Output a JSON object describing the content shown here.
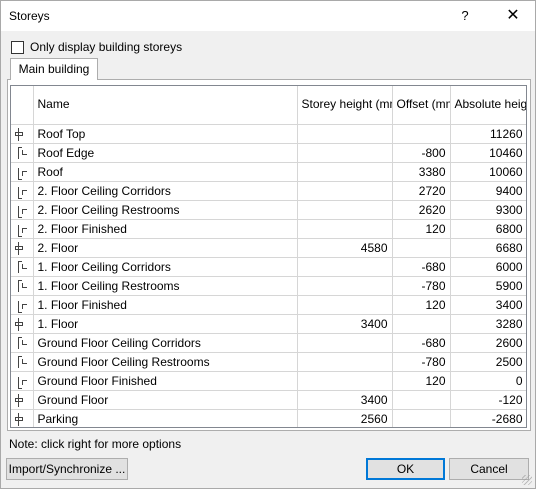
{
  "window": {
    "title": "Storeys",
    "help": "?",
    "close": "✕"
  },
  "only_building_label": "Only display building storeys",
  "tab_label": "Main building",
  "columns": {
    "name": "Name",
    "storey_height": "Storey height (mm)",
    "offset": "Offset (mm)",
    "absolute": "Absolute height (mm)"
  },
  "rows": [
    {
      "icon": "storey",
      "name": "Roof Top",
      "storey_height": "",
      "offset": "",
      "absolute": "11260"
    },
    {
      "icon": "above",
      "name": "Roof Edge",
      "storey_height": "",
      "offset": "-800",
      "absolute": "10460"
    },
    {
      "icon": "below",
      "name": "Roof",
      "storey_height": "",
      "offset": "3380",
      "absolute": "10060"
    },
    {
      "icon": "below",
      "name": "2. Floor Ceiling Corridors",
      "storey_height": "",
      "offset": "2720",
      "absolute": "9400"
    },
    {
      "icon": "below",
      "name": "2. Floor Ceiling Restrooms",
      "storey_height": "",
      "offset": "2620",
      "absolute": "9300"
    },
    {
      "icon": "below",
      "name": "2. Floor Finished",
      "storey_height": "",
      "offset": "120",
      "absolute": "6800"
    },
    {
      "icon": "storey",
      "name": "2. Floor",
      "storey_height": "4580",
      "offset": "",
      "absolute": "6680"
    },
    {
      "icon": "above",
      "name": "1. Floor Ceiling Corridors",
      "storey_height": "",
      "offset": "-680",
      "absolute": "6000"
    },
    {
      "icon": "above",
      "name": "1. Floor Ceiling Restrooms",
      "storey_height": "",
      "offset": "-780",
      "absolute": "5900"
    },
    {
      "icon": "below",
      "name": "1. Floor Finished",
      "storey_height": "",
      "offset": "120",
      "absolute": "3400"
    },
    {
      "icon": "storey",
      "name": "1. Floor",
      "storey_height": "3400",
      "offset": "",
      "absolute": "3280"
    },
    {
      "icon": "above",
      "name": "Ground Floor Ceiling Corridors",
      "storey_height": "",
      "offset": "-680",
      "absolute": "2600"
    },
    {
      "icon": "above",
      "name": "Ground Floor Ceiling Restrooms",
      "storey_height": "",
      "offset": "-780",
      "absolute": "2500"
    },
    {
      "icon": "below",
      "name": "Ground Floor Finished",
      "storey_height": "",
      "offset": "120",
      "absolute": "0"
    },
    {
      "icon": "storey",
      "name": "Ground Floor",
      "storey_height": "3400",
      "offset": "",
      "absolute": "-120"
    },
    {
      "icon": "storey",
      "name": "Parking",
      "storey_height": "2560",
      "offset": "",
      "absolute": "-2680"
    }
  ],
  "note": "Note: click right for more options",
  "buttons": {
    "import": "Import/Synchronize ...",
    "ok": "OK",
    "cancel": "Cancel"
  }
}
